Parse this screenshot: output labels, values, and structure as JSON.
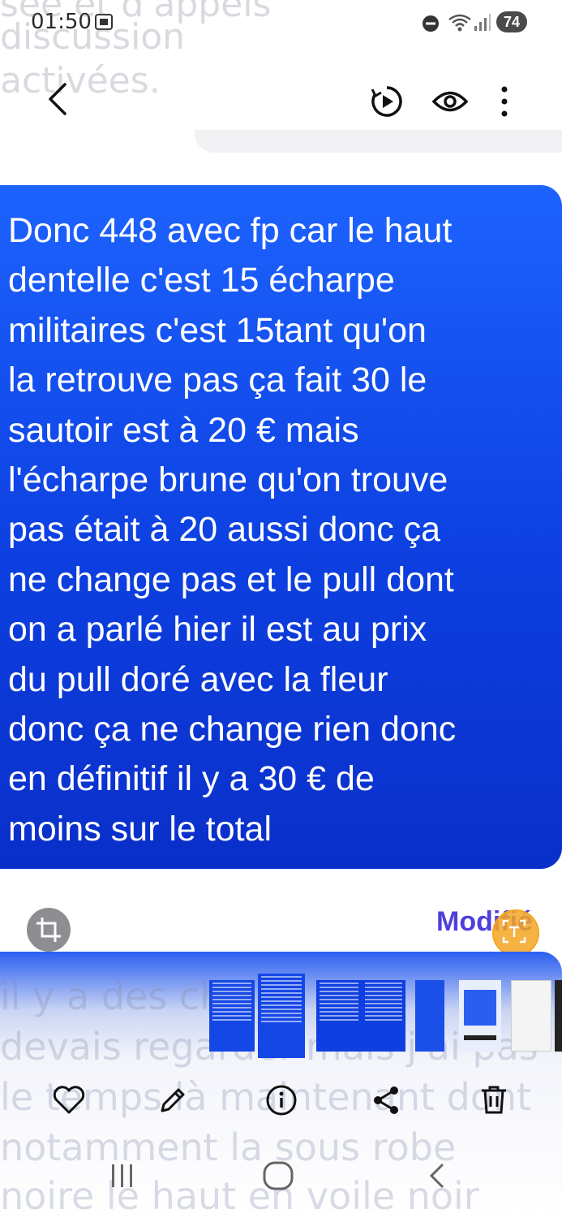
{
  "status_bar": {
    "time": "01:50",
    "battery": "74"
  },
  "background_top_lines": [
    "sée et d'appels",
    "discussion",
    "activées."
  ],
  "toolbar": {
    "back_icon": "chevron-left-icon",
    "rotate_icon": "motion-photo-icon",
    "view_icon": "eye-icon",
    "more_icon": "more-vertical-icon"
  },
  "message": {
    "lines": [
      "Donc 448 avec fp car le haut",
      "dentelle c'est 15 écharpe",
      "militaires c'est 15tant  qu'on",
      "la retrouve pas ça fait 30 le",
      "sautoir est à 20 € mais",
      "l'écharpe brune qu'on trouve",
      "pas était à 20 aussi donc ça",
      "ne change pas et le pull dont",
      "on a parlé hier il est au prix",
      "du pull doré avec la fleur",
      "donc ça ne change rien donc",
      "en définitif il y a 30 € de",
      "moins sur le total"
    ],
    "status": "Modifié",
    "colors": {
      "bubble": "#1d63ff",
      "text": "#ffffff",
      "status": "#4f3fd9"
    }
  },
  "background_bottom_lines": [
    "il y a des ch",
    "devais regarder mais j'ai pas",
    "le temps là maintenant dont",
    "notamment la sous robe",
    "noire le haut en voile noir"
  ],
  "actions": [
    {
      "name": "favorite-button",
      "icon": "heart-icon"
    },
    {
      "name": "edit-button",
      "icon": "pencil-icon"
    },
    {
      "name": "info-button",
      "icon": "info-icon"
    },
    {
      "name": "share-button",
      "icon": "share-icon"
    },
    {
      "name": "delete-button",
      "icon": "trash-icon"
    }
  ],
  "nav_bar": {
    "recents_icon": "recents-icon",
    "home_icon": "home-icon",
    "back_icon": "back-icon"
  }
}
